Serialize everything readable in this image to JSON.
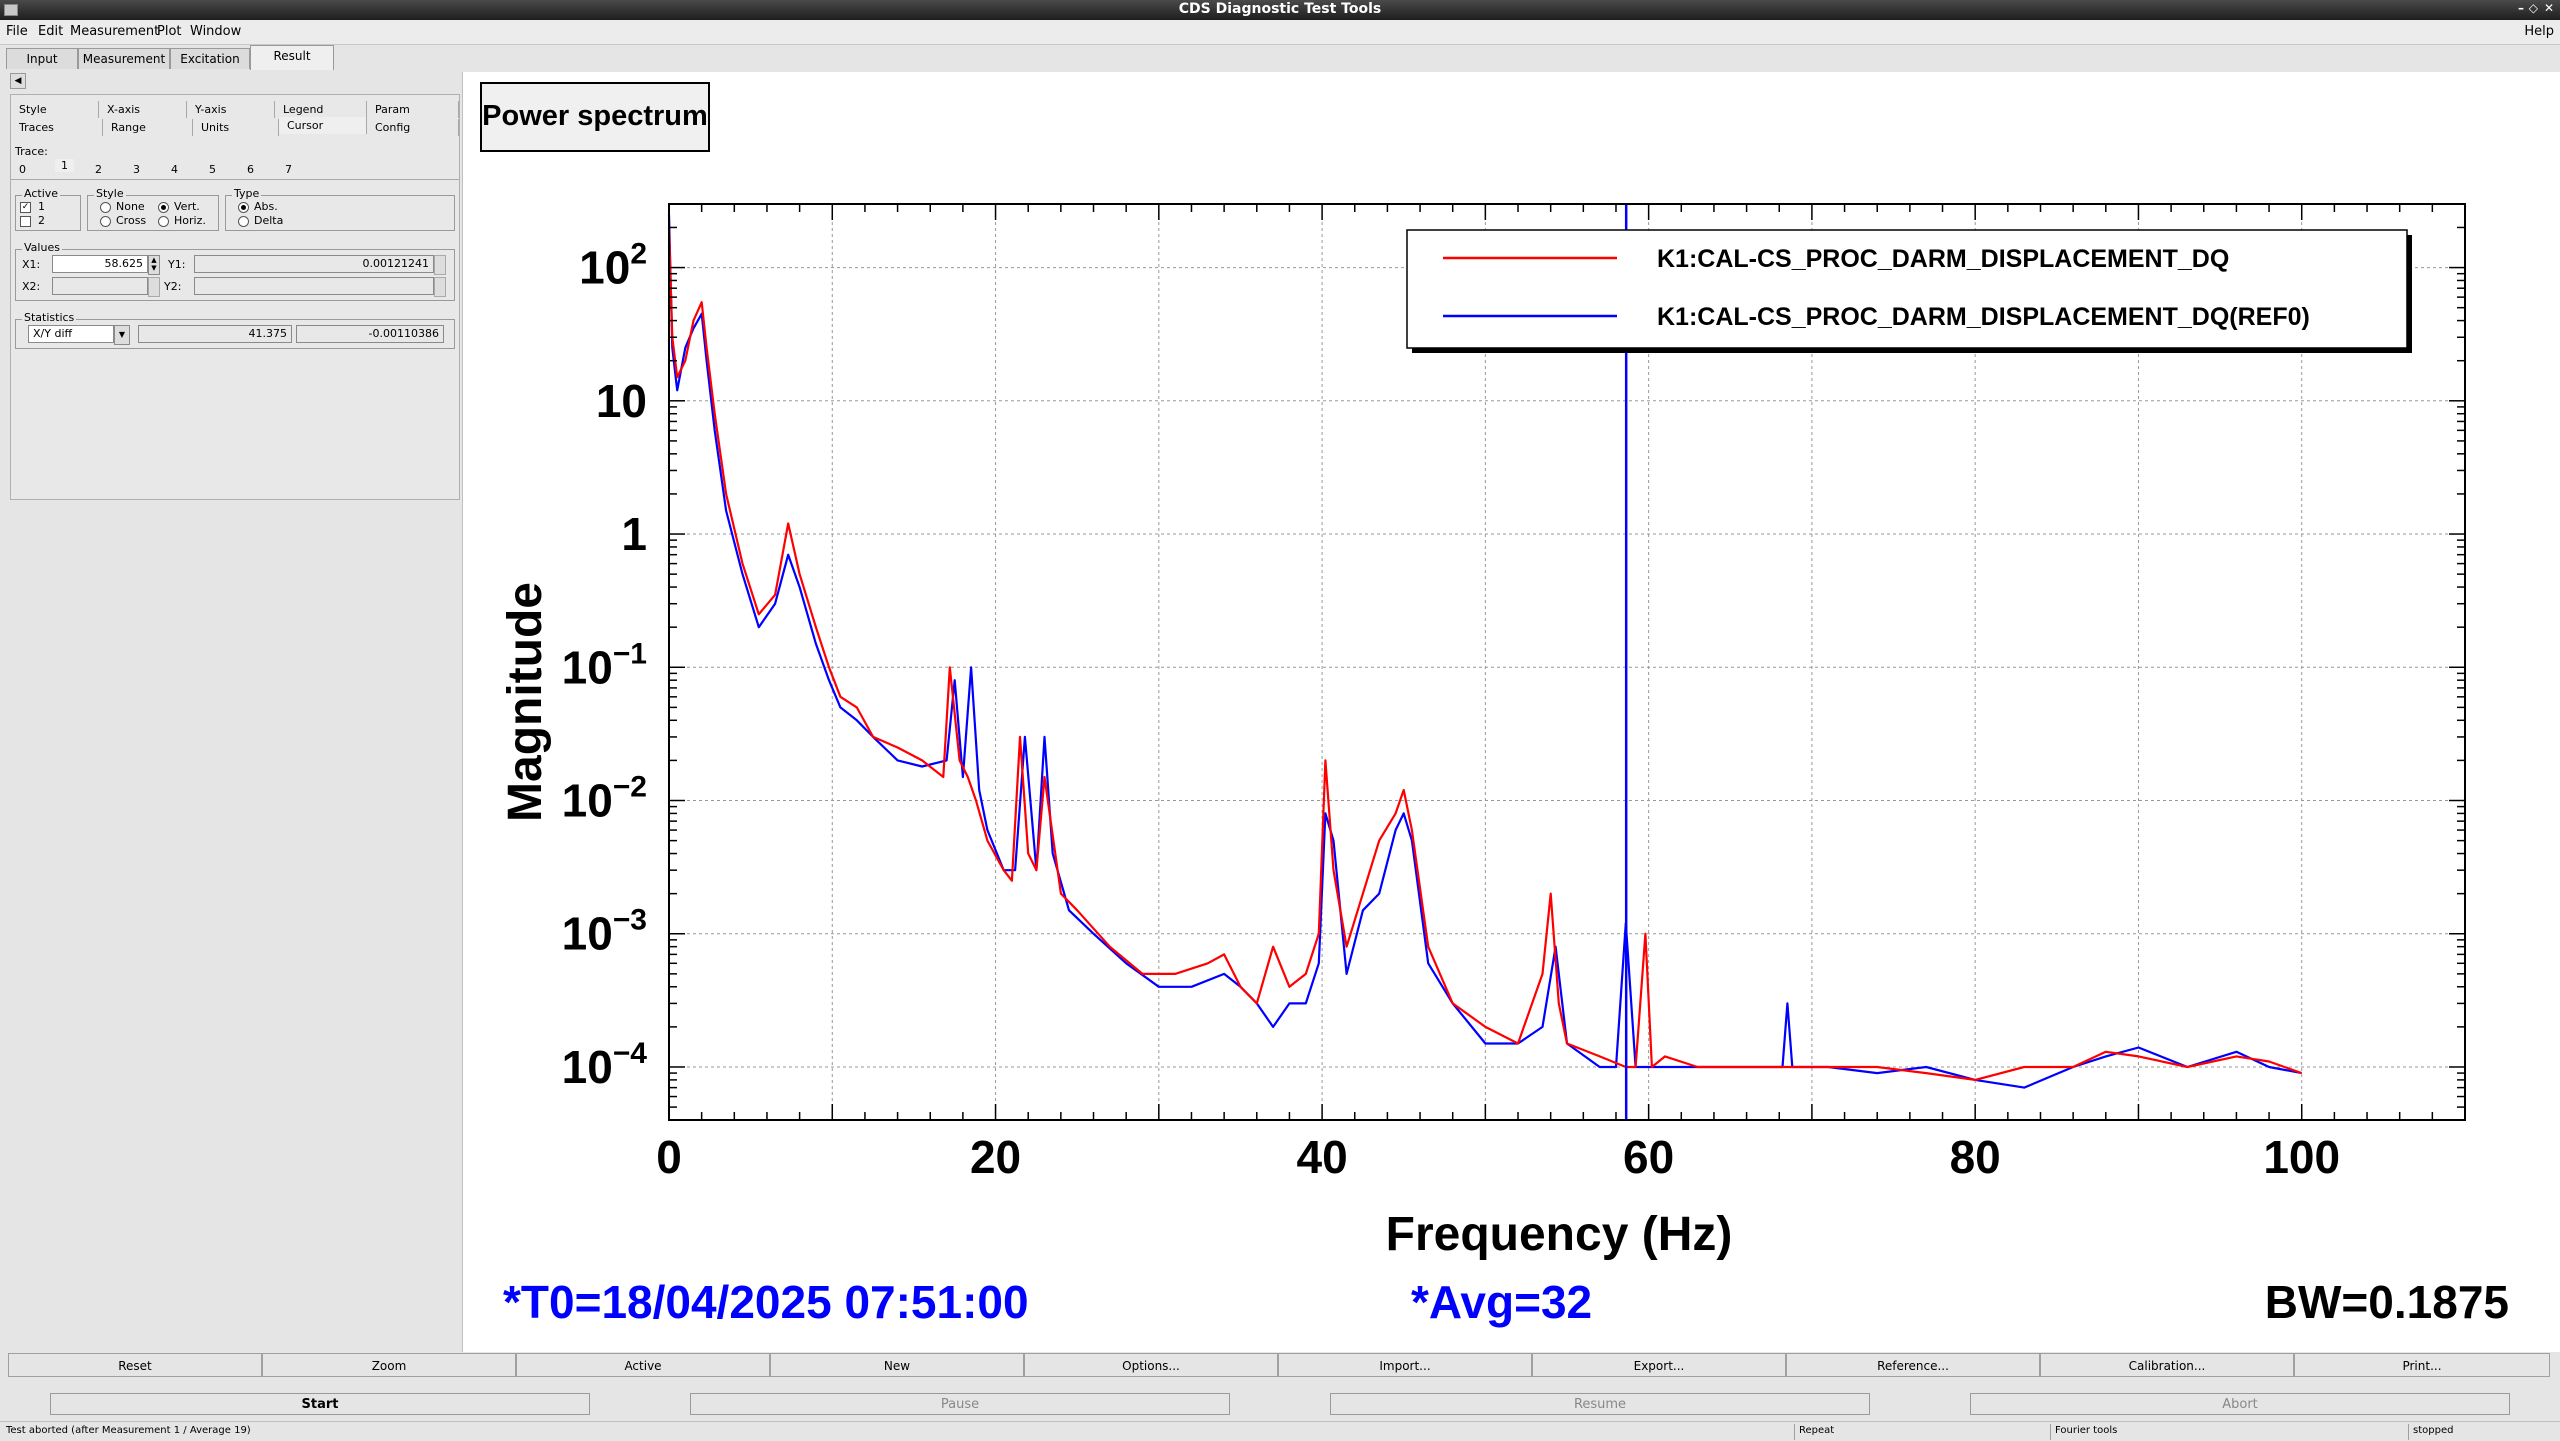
{
  "window": {
    "title": "CDS Diagnostic Test Tools",
    "help": "Help"
  },
  "menu": {
    "file": "File",
    "edit": "Edit",
    "measurement": "Measurement",
    "plot": "Plot",
    "window": "Window"
  },
  "tabs": [
    "Input",
    "Measurement",
    "Excitation",
    "Result"
  ],
  "settings": {
    "row1": [
      "Style",
      "X-axis",
      "Y-axis",
      "Legend",
      "Param"
    ],
    "row2": [
      "Traces",
      "Range",
      "Units",
      "Cursor",
      "Config"
    ],
    "trace_label": "Trace:",
    "traces": [
      "0",
      "1",
      "2",
      "3",
      "4",
      "5",
      "6",
      "7"
    ],
    "active_label": "Active",
    "active_1": "1",
    "active_2": "2",
    "style_label": "Style",
    "style_none": "None",
    "style_cross": "Cross",
    "style_vert": "Vert.",
    "style_horiz": "Horiz.",
    "type_label": "Type",
    "type_abs": "Abs.",
    "type_delta": "Delta",
    "values_label": "Values",
    "x1_label": "X1:",
    "x1_value": "58.625",
    "y1_label": "Y1:",
    "y1_value": "0.00121241",
    "x2_label": "X2:",
    "y2_label": "Y2:",
    "statistics_label": "Statistics",
    "stat_mode": "X/Y diff",
    "stat_x": "41.375",
    "stat_y": "-0.00110386"
  },
  "plot": {
    "title_box": "Power spectrum",
    "t0": "*T0=18/04/2025 07:51:00",
    "avg": "*Avg=32",
    "bw": "BW=0.1875",
    "colors": {
      "ref": "#0000ff",
      "live": "#ff0000",
      "cursor": "#0000ff"
    }
  },
  "chart_data": {
    "type": "line",
    "xlabel": "Frequency (Hz)",
    "ylabel": "Magnitude",
    "xlim": [
      0,
      110
    ],
    "ylim": [
      4e-05,
      300
    ],
    "y_scale": "log",
    "grid": true,
    "legend_position": "top-right",
    "x_ticks": [
      "0",
      "20",
      "40",
      "60",
      "80",
      "100"
    ],
    "y_ticks": [
      {
        "base": "10",
        "exp": "2"
      },
      {
        "base": "10",
        "exp": ""
      },
      {
        "base": "1",
        "exp": ""
      },
      {
        "base": "10",
        "exp": "−1"
      },
      {
        "base": "10",
        "exp": "−2"
      },
      {
        "base": "10",
        "exp": "−3"
      },
      {
        "base": "10",
        "exp": "−4"
      }
    ],
    "cursor_x": 58.625,
    "series": [
      {
        "name": "K1:CAL-CS_PROC_DARM_DISPLACEMENT_DQ",
        "x": [
          0,
          0.2,
          0.5,
          1,
          1.5,
          2,
          2.3,
          2.8,
          3.5,
          4.5,
          5.5,
          6.5,
          7.3,
          8,
          9,
          9.8,
          10.5,
          11.5,
          12.5,
          14,
          15.5,
          16.8,
          17.2,
          17.8,
          18.3,
          18.8,
          19.5,
          20.5,
          21,
          21.5,
          22,
          22.5,
          23,
          24,
          25,
          27,
          29,
          31,
          33,
          34,
          35,
          36,
          37,
          38,
          39,
          39.8,
          40.2,
          40.7,
          41.5,
          42.5,
          43.5,
          44.5,
          45,
          45.5,
          46.5,
          48,
          50,
          52,
          53.5,
          54,
          54.5,
          55,
          57,
          58.6,
          59.2,
          59.8,
          60.2,
          61,
          63,
          66,
          68.5,
          71,
          74,
          77,
          80,
          83,
          86,
          88,
          90,
          93,
          96,
          98,
          100
        ],
        "y": [
          200,
          30,
          15,
          20,
          40,
          55,
          25,
          8,
          2,
          0.6,
          0.25,
          0.35,
          1.2,
          0.5,
          0.2,
          0.1,
          0.06,
          0.05,
          0.03,
          0.025,
          0.02,
          0.015,
          0.1,
          0.02,
          0.015,
          0.01,
          0.005,
          0.003,
          0.0025,
          0.03,
          0.004,
          0.003,
          0.015,
          0.002,
          0.0015,
          0.0008,
          0.0005,
          0.0005,
          0.0006,
          0.0007,
          0.0004,
          0.0003,
          0.0008,
          0.0004,
          0.0005,
          0.001,
          0.02,
          0.003,
          0.0008,
          0.002,
          0.005,
          0.008,
          0.012,
          0.006,
          0.0008,
          0.0003,
          0.0002,
          0.00015,
          0.0005,
          0.002,
          0.0003,
          0.00015,
          0.00012,
          0.0001,
          0.0001,
          0.001,
          0.0001,
          0.00012,
          0.0001,
          0.0001,
          0.0001,
          0.0001,
          0.0001,
          9e-05,
          8e-05,
          0.0001,
          0.0001,
          0.00013,
          0.00012,
          0.0001,
          0.00012,
          0.00011,
          9e-05
        ]
      },
      {
        "name": "K1:CAL-CS_PROC_DARM_DISPLACEMENT_DQ(REF0)",
        "x": [
          0,
          0.2,
          0.5,
          1,
          1.5,
          2,
          2.3,
          2.8,
          3.5,
          4.5,
          5.5,
          6.5,
          7.3,
          8,
          9,
          9.8,
          10.5,
          11.5,
          12.5,
          14,
          15.5,
          17,
          17.5,
          18,
          18.5,
          19,
          19.5,
          20.5,
          21.2,
          21.8,
          22.5,
          23,
          23.5,
          24.5,
          26,
          28,
          30,
          32,
          34,
          35,
          36,
          37,
          38,
          39,
          39.8,
          40.2,
          40.7,
          41.5,
          42.5,
          43.5,
          44.5,
          45,
          45.5,
          46.5,
          48,
          50,
          52,
          53.5,
          54.3,
          55,
          57,
          58,
          58.6,
          59.2,
          61,
          63,
          66,
          68.2,
          68.5,
          68.8,
          71,
          74,
          77,
          80,
          83,
          86,
          88,
          90,
          93,
          96,
          98,
          100
        ],
        "y": [
          250,
          25,
          12,
          25,
          35,
          45,
          20,
          6,
          1.5,
          0.5,
          0.2,
          0.3,
          0.7,
          0.4,
          0.15,
          0.08,
          0.05,
          0.04,
          0.03,
          0.02,
          0.018,
          0.02,
          0.08,
          0.015,
          0.1,
          0.012,
          0.006,
          0.003,
          0.003,
          0.03,
          0.003,
          0.03,
          0.004,
          0.0015,
          0.001,
          0.0006,
          0.0004,
          0.0004,
          0.0005,
          0.0004,
          0.0003,
          0.0002,
          0.0003,
          0.0003,
          0.0006,
          0.008,
          0.005,
          0.0005,
          0.0015,
          0.002,
          0.006,
          0.008,
          0.005,
          0.0006,
          0.0003,
          0.00015,
          0.00015,
          0.0002,
          0.0008,
          0.00015,
          0.0001,
          0.0001,
          0.0012,
          0.0001,
          0.0001,
          0.0001,
          0.0001,
          0.0001,
          0.0003,
          0.0001,
          0.0001,
          9e-05,
          0.0001,
          8e-05,
          7e-05,
          0.0001,
          0.00012,
          0.00014,
          0.0001,
          0.00013,
          0.0001,
          9e-05
        ]
      }
    ]
  },
  "buttons": [
    "Reset",
    "Zoom",
    "Active",
    "New",
    "Options...",
    "Import...",
    "Export...",
    "Reference...",
    "Calibration...",
    "Print..."
  ],
  "controls": {
    "start": "Start",
    "pause": "Pause",
    "resume": "Resume",
    "abort": "Abort"
  },
  "status": {
    "message": "Test aborted (after Measurement 1 / Average 19)",
    "repeat": "Repeat",
    "fourier": "Fourier tools",
    "state": "stopped"
  }
}
